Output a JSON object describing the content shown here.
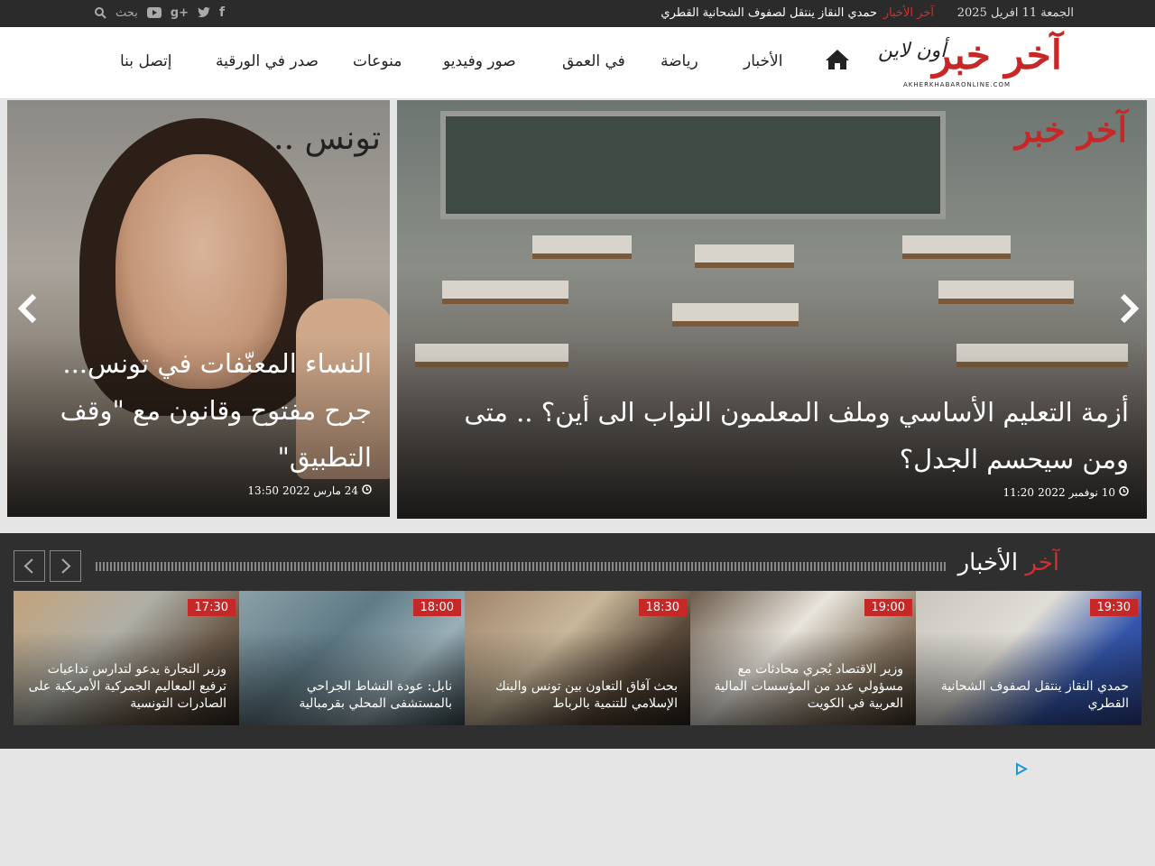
{
  "topbar": {
    "date": "الجمعة 11 افريل 2025",
    "ticker_label": "آخر الأخبار",
    "ticker_text": "حمدي النقاز ينتقل لصفوف الشحانية القطري",
    "search_label": "بحث",
    "social": [
      "facebook-icon",
      "twitter-icon",
      "google-plus-icon",
      "youtube-icon",
      "search-icon"
    ]
  },
  "header": {
    "logo_main": "آخر خبر",
    "logo_sub": "أون لاين",
    "logo_url": "AKHERKHABARONLINE.COM",
    "nav": [
      "الأخبار",
      "رياضة",
      "في العمق",
      "صور وفيديو",
      "منوعات",
      "صدر في الورقية",
      "إتصل بنا"
    ]
  },
  "slider": {
    "slides": [
      {
        "title": "أزمة التعليم الأساسي وملف المعلمون النواب الى أين؟ .. متى ومن سيحسم الجدل؟",
        "date": "10 نوفمبر 2022",
        "time": "11:20"
      },
      {
        "title": "النساء المعنّفات في تونس... جرح مفتوح وقانون مع \"وقف التطبيق\"",
        "date": "24 مارس 2022",
        "time": "13:50",
        "image_text": "تونس .."
      }
    ]
  },
  "latest": {
    "title_red": "آخر",
    "title_white": "الأخبار",
    "items": [
      {
        "time": "19:30",
        "text": "حمدي النقاز ينتقل لصفوف الشحانية القطري"
      },
      {
        "time": "19:00",
        "text": "وزير الاقتصاد يُجري محادثات مع مسؤولي عدد من المؤسسات المالية العربية في الكويت"
      },
      {
        "time": "18:30",
        "text": "بحث آفاق التعاون بين تونس والبنك الإسلامي للتنمية بالرباط"
      },
      {
        "time": "18:00",
        "text": "نابل: عودة النشاط الجراحي بالمستشفى المحلي بقرمبالية"
      },
      {
        "time": "17:30",
        "text": "وزير التجارة يدعو لتدارس تداعيات ترفيع المعاليم الجمركية الأمريكية على الصادرات التونسية"
      }
    ]
  },
  "colors": {
    "accent": "#c62828",
    "dark": "#2f2f2f",
    "topbar": "#2b2b2b"
  }
}
